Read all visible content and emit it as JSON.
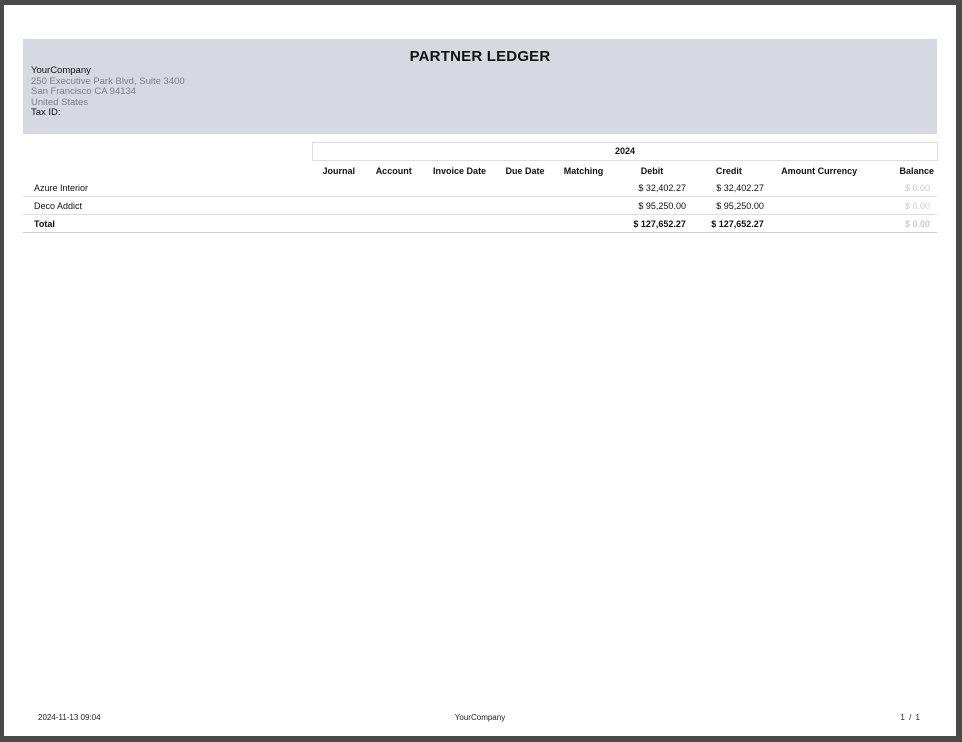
{
  "report": {
    "title": "PARTNER LEDGER"
  },
  "company": {
    "name": "YourCompany",
    "address_lines": [
      "250 Executive Park Blvd, Suite 3400",
      "San Francisco CA 94134",
      "United States"
    ],
    "tax_id_label": "Tax ID:"
  },
  "period": {
    "label": "2024"
  },
  "columns": {
    "journal": "Journal",
    "account": "Account",
    "invoice_date": "Invoice Date",
    "due_date": "Due Date",
    "matching": "Matching",
    "debit": "Debit",
    "credit": "Credit",
    "amount_currency": "Amount Currency",
    "balance": "Balance"
  },
  "rows": [
    {
      "partner": "Azure Interior",
      "debit": "$ 32,402.27",
      "credit": "$ 32,402.27",
      "balance": "$ 0.00"
    },
    {
      "partner": "Deco Addict",
      "debit": "$ 95,250.00",
      "credit": "$ 95,250.00",
      "balance": "$ 0.00"
    }
  ],
  "total": {
    "label": "Total",
    "debit": "$ 127,652.27",
    "credit": "$ 127,652.27",
    "balance": "$ 0.00"
  },
  "footer": {
    "timestamp": "2024-11-13 09:04",
    "company": "YourCompany",
    "page": "1 / 1"
  },
  "colors": {
    "header_band": "#d6d9df",
    "muted_balance": "#c8ccd2",
    "viewer_background": "#4a4a4a"
  }
}
